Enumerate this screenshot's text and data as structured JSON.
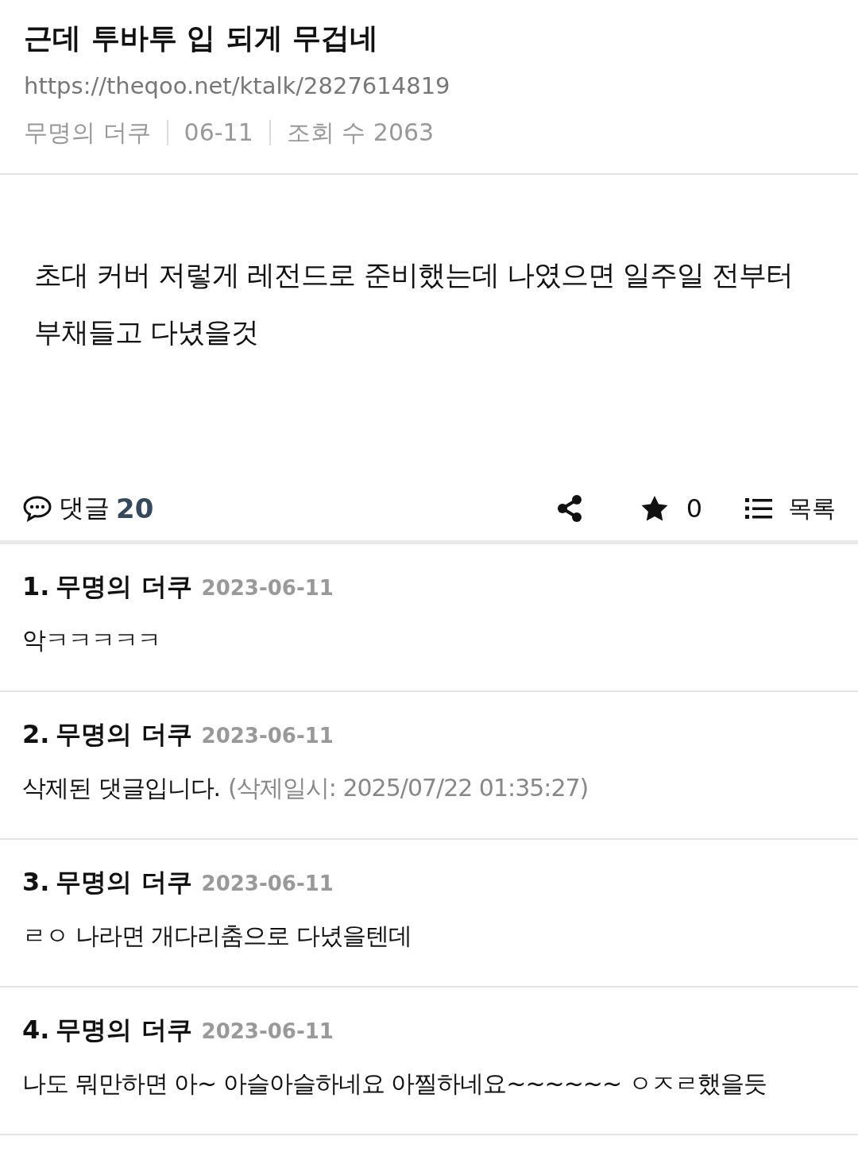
{
  "post": {
    "title": "근데 투바투 입 되게 무겁네",
    "url": "https://theqoo.net/ktalk/2827614819",
    "meta": [
      "무명의 더쿠",
      "06-11",
      "조회 수 2063"
    ],
    "body": "초대 커버 저렇게 레전드로 준비했는데 나였으면 일주일 전부터 부채들고 다녔을것"
  },
  "actions": {
    "comments_label": "댓글",
    "comments_count": "20",
    "star_count": "0",
    "list_label": "목록"
  },
  "comments": [
    {
      "number": "1.",
      "author": "무명의 더쿠",
      "date": "2023-06-11",
      "text": "악ㅋㅋㅋㅋㅋ"
    },
    {
      "number": "2.",
      "author": "무명의 더쿠",
      "date": "2023-06-11",
      "text": "삭제된 댓글입니다.",
      "note": "(삭제일시: 2025/07/22 01:35:27)"
    },
    {
      "number": "3.",
      "author": "무명의 더쿠",
      "date": "2023-06-11",
      "text": "ㄹㅇ 나라면 개다리춤으로 다녔을텐데"
    },
    {
      "number": "4.",
      "author": "무명의 더쿠",
      "date": "2023-06-11",
      "text": "나도 뭐만하면 아~ 아슬아슬하네요 아찔하네요~~~~~~ ㅇㅈㄹ했을듯"
    }
  ]
}
